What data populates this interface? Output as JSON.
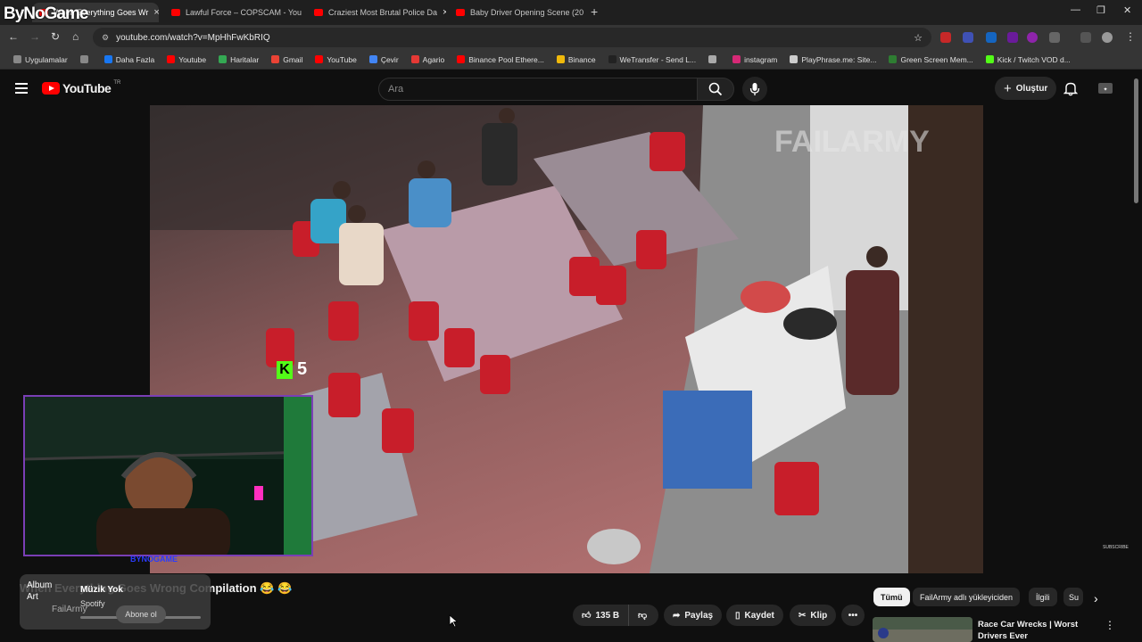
{
  "overlay": {
    "brand": "ByNoGame"
  },
  "browser": {
    "tabs": [
      {
        "title": "When Everything Goes Wr",
        "active": true
      },
      {
        "title": "Lawful Force – COPSCAM - You"
      },
      {
        "title": "Craziest Most Brutal Police Da"
      },
      {
        "title": "Baby Driver Opening Scene (20"
      }
    ],
    "url": "youtube.com/watch?v=MpHhFwKbRIQ",
    "bookmarks": [
      {
        "label": "Uygulamalar",
        "color": "#888888"
      },
      {
        "label": "",
        "color": "#888888"
      },
      {
        "label": "Daha Fazla",
        "color": "#1877f2"
      },
      {
        "label": "Youtube",
        "color": "#ff0000"
      },
      {
        "label": "Haritalar",
        "color": "#34a853"
      },
      {
        "label": "Gmail",
        "color": "#ea4335"
      },
      {
        "label": "YouTube",
        "color": "#ff0000"
      },
      {
        "label": "Çevir",
        "color": "#4285f4"
      },
      {
        "label": "Agario",
        "color": "#e53935"
      },
      {
        "label": "Binance Pool Ethere...",
        "color": "#ff0000"
      },
      {
        "label": "Binance",
        "color": "#f0b90b"
      },
      {
        "label": "WeTransfer - Send L...",
        "color": "#222222"
      },
      {
        "label": "",
        "color": "#aaaaaa"
      },
      {
        "label": "instagram",
        "color": "#d62976"
      },
      {
        "label": "PlayPhrase.me: Site...",
        "color": "#cccccc"
      },
      {
        "label": "Green Screen Mem...",
        "color": "#2e7d32"
      },
      {
        "label": "Kick / Twitch VOD d...",
        "color": "#53fc18"
      }
    ]
  },
  "youtube": {
    "logo": "YouTube",
    "region": "TR",
    "search_placeholder": "Ara",
    "create_label": "Oluştur",
    "video_title": "When Everything Goes Wrong Compilation 😂 😂",
    "video_watermark": "FAILARMY",
    "subscribe_watermark": "SUBSCRIBE",
    "channel": "FailArmy",
    "subscribe": "Abone ol",
    "actions": {
      "likes": "135 B",
      "share": "Paylaş",
      "save": "Kaydet",
      "clip": "Klip"
    },
    "chips": [
      "Tümü",
      "FailArmy adlı yükleyiciden",
      "İlgili",
      "Su"
    ],
    "recommendation": {
      "title": "Race Car Wrecks | Worst Drivers Ever"
    }
  },
  "stream": {
    "kick_count": "5",
    "streamer_name": "BYNOGAME"
  },
  "spotify": {
    "album_art": "Album Art",
    "track": "Müzik Yok",
    "artist": "Spotify"
  }
}
